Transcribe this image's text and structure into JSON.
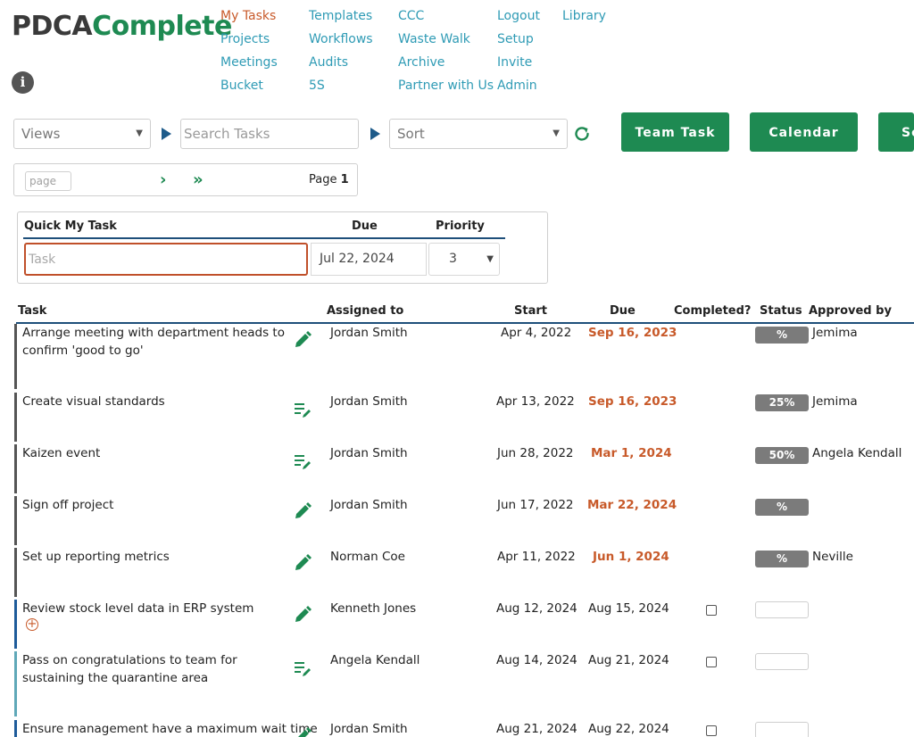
{
  "logo": {
    "part1": "PDCA",
    "part2": "Complete"
  },
  "nav": {
    "col1": [
      "My Tasks",
      "Projects",
      "Meetings",
      "Bucket"
    ],
    "col2": [
      "Templates",
      "Workflows",
      "Audits",
      "5S"
    ],
    "col3": [
      "CCC",
      "Waste Walk",
      "Archive",
      "Partner with Us"
    ],
    "col4": [
      "Logout",
      "Setup",
      "Invite",
      "Admin"
    ],
    "col5": [
      "Library"
    ],
    "active": "My Tasks"
  },
  "toolbar": {
    "views_label": "Views",
    "search_placeholder": "Search Tasks",
    "sort_label": "Sort",
    "team_task_label": "Team Task",
    "calendar_label": "Calendar",
    "third_button_label": "Se"
  },
  "pager": {
    "page_placeholder": "page",
    "page_prefix": "Page",
    "page_number": "1"
  },
  "quick": {
    "header_task": "Quick My Task",
    "header_due": "Due",
    "header_priority": "Priority",
    "task_placeholder": "Task",
    "due_value": "Jul 22, 2024",
    "priority_value": "3"
  },
  "table": {
    "headers": {
      "task": "Task",
      "assigned": "Assigned to",
      "start": "Start",
      "due": "Due",
      "completed": "Completed?",
      "status": "Status",
      "approved": "Approved by"
    },
    "rows": [
      {
        "task": "Arrange meeting with department heads to confirm 'good to go'",
        "icon": "pencil-icon",
        "assigned": "Jordan Smith",
        "start": "Apr 4, 2022",
        "due": "Sep 16, 2023",
        "overdue": true,
        "status": "%",
        "approved": "Jemima"
      },
      {
        "task": "Create visual standards",
        "icon": "notes-edit-icon",
        "assigned": "Jordan Smith",
        "start": "Apr 13, 2022",
        "due": "Sep 16, 2023",
        "overdue": true,
        "status": "25%",
        "approved": "Jemima"
      },
      {
        "task": "Kaizen event",
        "icon": "notes-edit-icon",
        "assigned": "Jordan Smith",
        "start": "Jun 28, 2022",
        "due": "Mar 1, 2024",
        "overdue": true,
        "status": "50%",
        "approved": "Angela Kendall"
      },
      {
        "task": "Sign off project",
        "icon": "pencil-icon",
        "assigned": "Jordan Smith",
        "start": "Jun 17, 2022",
        "due": "Mar 22, 2024",
        "overdue": true,
        "status": "%",
        "approved": ""
      },
      {
        "task": "Set up reporting metrics",
        "icon": "pencil-icon",
        "assigned": "Norman Coe",
        "start": "Apr 11, 2022",
        "due": "Jun 1, 2024",
        "overdue": true,
        "status": "%",
        "approved": "Neville"
      },
      {
        "task": "Review stock level data in ERP system",
        "icon": "pencil-icon",
        "assigned": "Kenneth Jones",
        "start": "Aug 12, 2024",
        "due": "Aug 15, 2024",
        "overdue": false,
        "status": "",
        "approved": ""
      },
      {
        "task": "Pass on congratulations to team for sustaining the quarantine area",
        "icon": "notes-edit-icon",
        "assigned": "Angela Kendall",
        "start": "Aug 14, 2024",
        "due": "Aug 21, 2024",
        "overdue": false,
        "status": "",
        "approved": ""
      },
      {
        "task": "Ensure management have a maximum wait time",
        "icon": "pencil-icon",
        "assigned": "Jordan Smith",
        "start": "Aug 21, 2024",
        "due": "Aug 22, 2024",
        "overdue": false,
        "status": "",
        "approved": ""
      }
    ]
  },
  "colors": {
    "brand_green": "#1e8a52",
    "link_blue": "#2f9bb5",
    "overdue_orange": "#c85a2a",
    "rule_navy": "#1e4f7a"
  }
}
